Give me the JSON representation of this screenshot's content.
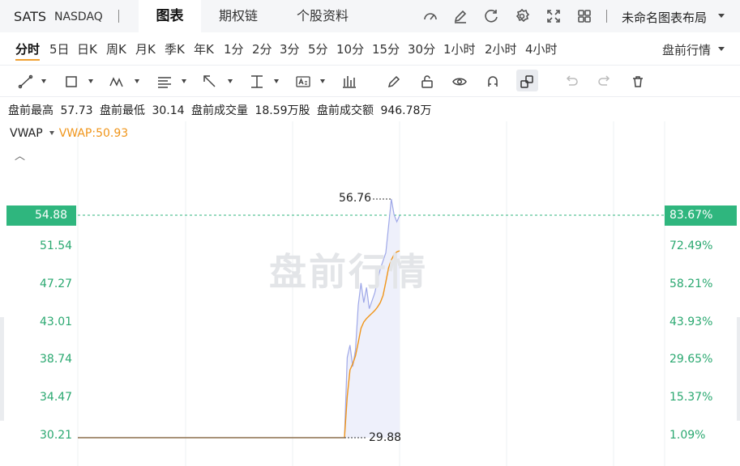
{
  "header": {
    "ticker": "SATS",
    "exchange": "NASDAQ",
    "tabs": [
      "图表",
      "期权链",
      "个股资料"
    ],
    "layout_label": "未命名图表布局",
    "icons": [
      "gauge-icon",
      "edit-icon",
      "refresh-icon",
      "gear-icon",
      "fullscreen-icon",
      "grid-icon"
    ]
  },
  "periods": {
    "items": [
      "分时",
      "5日",
      "日K",
      "周K",
      "月K",
      "季K",
      "年K",
      "1分",
      "2分",
      "3分",
      "5分",
      "10分",
      "15分",
      "30分",
      "1小时",
      "2小时",
      "4小时"
    ],
    "active": "分时",
    "session_label": "盘前行情"
  },
  "toolbar": {
    "tools": [
      "line-tool-icon",
      "rectangle-tool-icon",
      "pattern-tool-icon",
      "fib-tool-icon",
      "arrow-tool-icon",
      "measure-tool-icon",
      "text-tool-icon",
      "indicator-icon",
      "pencil-icon",
      "lock-icon",
      "eye-icon",
      "magnet-icon",
      "link-icon",
      "undo-icon",
      "redo-icon",
      "trash-icon"
    ]
  },
  "stats": {
    "high_label": "盘前最高",
    "high": "57.73",
    "low_label": "盘前最低",
    "low": "30.14",
    "vol_label": "盘前成交量",
    "vol": "18.59万股",
    "amt_label": "盘前成交额",
    "amt": "946.78万"
  },
  "indicator": {
    "name": "VWAP",
    "value_text": "VWAP:50.93"
  },
  "chart": {
    "watermark": "盘前行情",
    "current_price": "54.88",
    "current_pct": "83.67%",
    "high_marker": "56.76",
    "low_marker": "29.88",
    "y_left": [
      "51.54",
      "47.27",
      "43.01",
      "38.74",
      "34.47",
      "30.21"
    ],
    "y_right": [
      "72.49%",
      "58.21%",
      "43.93%",
      "29.65%",
      "15.37%",
      "1.09%"
    ],
    "colors": {
      "up": "#2fb67e",
      "price_line": "#9fa8e8",
      "vwap_line": "#f0951a"
    }
  },
  "chart_data": {
    "type": "line",
    "title": "",
    "series": [
      {
        "name": "",
        "role": "price",
        "values": [
          29.88,
          29.88,
          29.88,
          29.88,
          29.88,
          29.88,
          29.88,
          29.88,
          38.9,
          40.3,
          37.9,
          39.8,
          44.8,
          47.3,
          45.1,
          46.8,
          44.4,
          45.3,
          46.2,
          47.6,
          48.9,
          49.8,
          50.7,
          53.7,
          56.76,
          55.0,
          54.2,
          54.88
        ]
      },
      {
        "name": "VWAP",
        "role": "vwap",
        "values": [
          29.88,
          29.88,
          29.88,
          29.88,
          29.88,
          29.88,
          29.88,
          29.88,
          34.5,
          37.5,
          38.2,
          39.1,
          40.6,
          42.2,
          42.9,
          43.3,
          43.6,
          43.9,
          44.2,
          44.6,
          45.1,
          45.9,
          47.4,
          49.0,
          49.9,
          50.5,
          50.8,
          50.93
        ]
      }
    ],
    "ylim": [
      29.0,
      57.5
    ],
    "grid": true
  }
}
